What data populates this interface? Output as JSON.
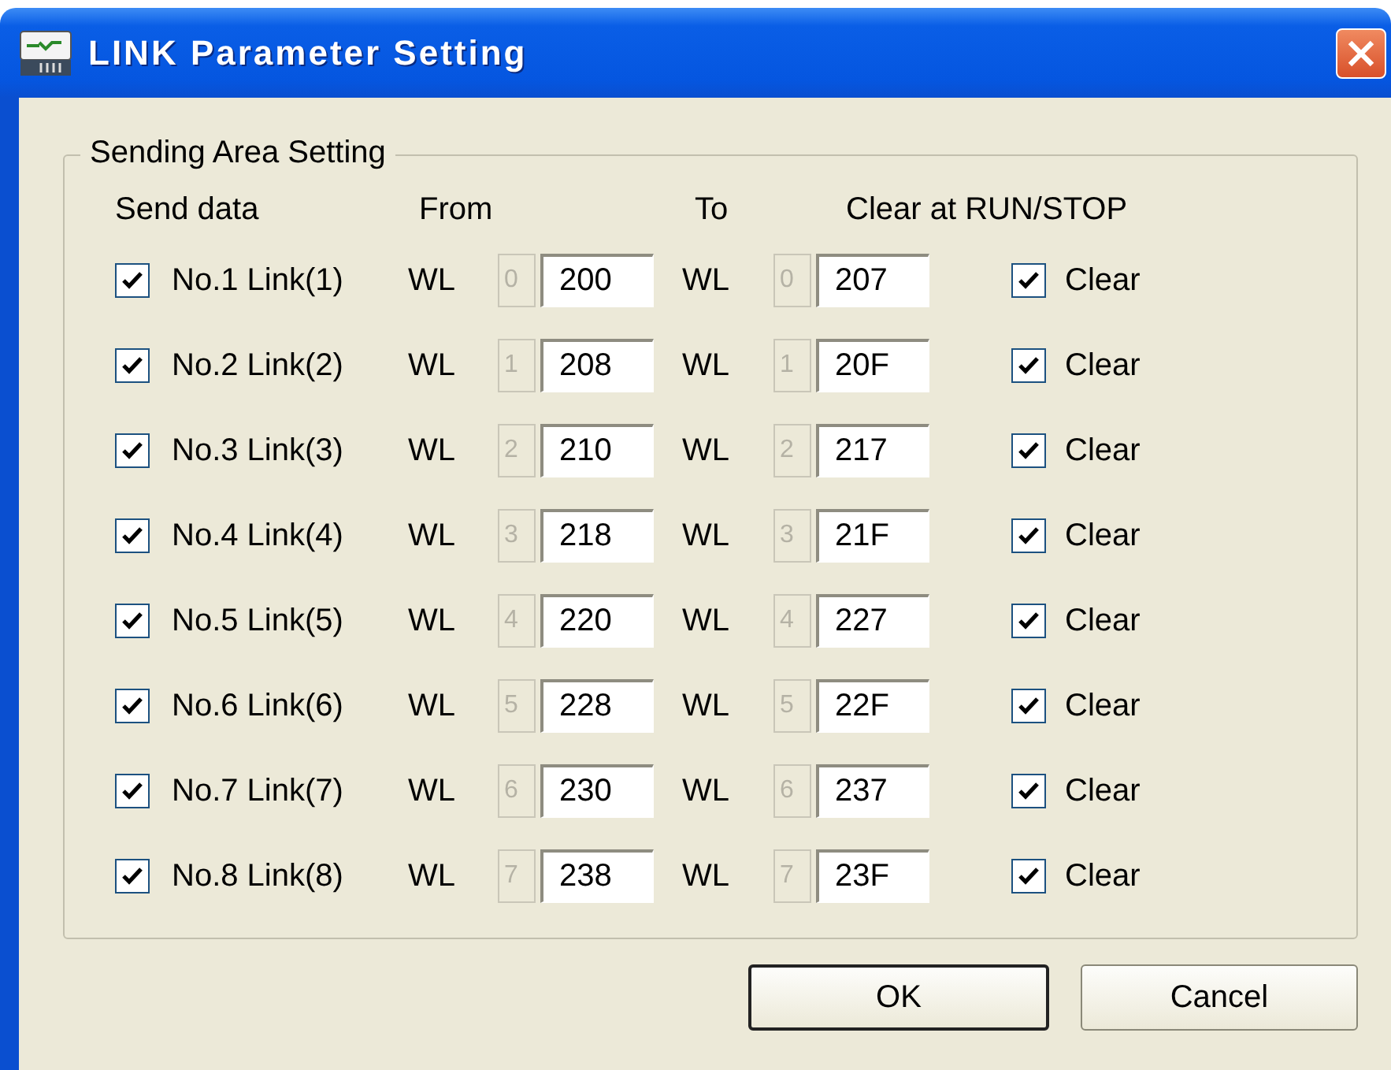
{
  "window": {
    "title": "LINK Parameter Setting"
  },
  "group": {
    "title": "Sending Area Setting",
    "headers": [
      "Send data",
      "From",
      "To",
      "Clear at RUN/STOP"
    ],
    "rows": [
      {
        "send_checked": true,
        "label": "No.1 Link(1)",
        "from_prefix": "WL",
        "from_area": "0",
        "from_address": "200",
        "to_prefix": "WL",
        "to_area": "0",
        "to_address": "207",
        "clear_checked": true,
        "clear_label": "Clear"
      },
      {
        "send_checked": true,
        "label": "No.2 Link(2)",
        "from_prefix": "WL",
        "from_area": "1",
        "from_address": "208",
        "to_prefix": "WL",
        "to_area": "1",
        "to_address": "20F",
        "clear_checked": true,
        "clear_label": "Clear"
      },
      {
        "send_checked": true,
        "label": "No.3 Link(3)",
        "from_prefix": "WL",
        "from_area": "2",
        "from_address": "210",
        "to_prefix": "WL",
        "to_area": "2",
        "to_address": "217",
        "clear_checked": true,
        "clear_label": "Clear"
      },
      {
        "send_checked": true,
        "label": "No.4 Link(4)",
        "from_prefix": "WL",
        "from_area": "3",
        "from_address": "218",
        "to_prefix": "WL",
        "to_area": "3",
        "to_address": "21F",
        "clear_checked": true,
        "clear_label": "Clear"
      },
      {
        "send_checked": true,
        "label": "No.5 Link(5)",
        "from_prefix": "WL",
        "from_area": "4",
        "from_address": "220",
        "to_prefix": "WL",
        "to_area": "4",
        "to_address": "227",
        "clear_checked": true,
        "clear_label": "Clear"
      },
      {
        "send_checked": true,
        "label": "No.6 Link(6)",
        "from_prefix": "WL",
        "from_area": "5",
        "from_address": "228",
        "to_prefix": "WL",
        "to_area": "5",
        "to_address": "22F",
        "clear_checked": true,
        "clear_label": "Clear"
      },
      {
        "send_checked": true,
        "label": "No.7 Link(7)",
        "from_prefix": "WL",
        "from_area": "6",
        "from_address": "230",
        "to_prefix": "WL",
        "to_area": "6",
        "to_address": "237",
        "clear_checked": true,
        "clear_label": "Clear"
      },
      {
        "send_checked": true,
        "label": "No.8 Link(8)",
        "from_prefix": "WL",
        "from_area": "7",
        "from_address": "238",
        "to_prefix": "WL",
        "to_area": "7",
        "to_address": "23F",
        "clear_checked": true,
        "clear_label": "Clear"
      }
    ]
  },
  "buttons": [
    {
      "label": "OK",
      "default": true
    },
    {
      "label": "Cancel",
      "default": false
    }
  ]
}
